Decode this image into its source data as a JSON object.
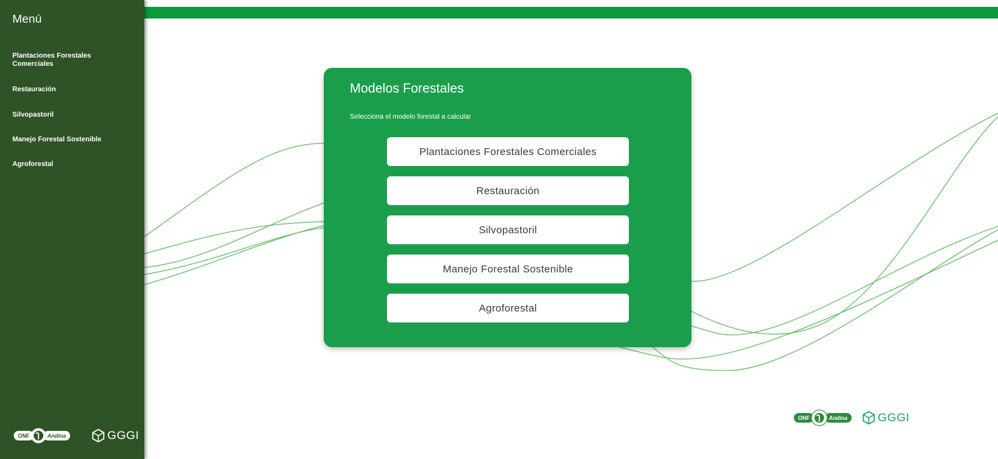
{
  "sidebar": {
    "title": "Menú",
    "items": [
      {
        "label": "Plantaciones Forestales\nComerciales"
      },
      {
        "label": "Restauración"
      },
      {
        "label": "Silvopastoril"
      },
      {
        "label": "Manejo Forestal Sostenible"
      },
      {
        "label": "Agroforestal"
      }
    ],
    "logos": {
      "onf": "ONF",
      "onf_sub": "Andina",
      "gggi": "GGGI"
    }
  },
  "card": {
    "title": "Modelos Forestales",
    "subtitle": "Selecciona el modelo forestal a calcular",
    "options": [
      {
        "label": "Plantaciones Forestales Comerciales"
      },
      {
        "label": "Restauración"
      },
      {
        "label": "Silvopastoril"
      },
      {
        "label": "Manejo Forestal Sostenible"
      },
      {
        "label": "Agroforestal"
      }
    ]
  },
  "footer_logos": {
    "onf": "ONF",
    "onf_sub": "Andina",
    "gggi": "GGGI"
  },
  "colors": {
    "sidebar": "#2e5326",
    "accent": "#0c9a3f",
    "card": "#1a9e4b",
    "wave": "#5cb85c"
  },
  "icons": {
    "onf_logo": "onf-globe-icon",
    "gggi_logo": "gggi-cube-icon"
  }
}
